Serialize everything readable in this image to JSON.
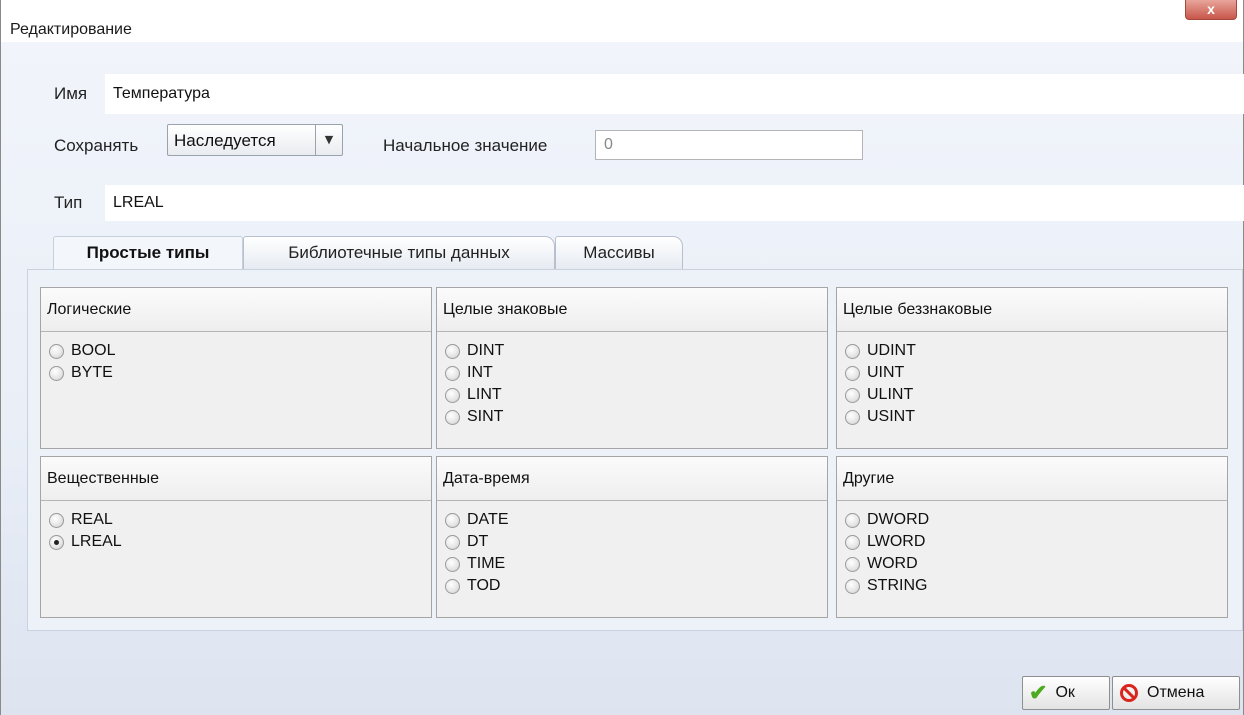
{
  "window": {
    "title": "Редактирование",
    "close_label": "x"
  },
  "form": {
    "name_label": "Имя",
    "name_value": "Температура",
    "save_label": "Сохранять",
    "save_value": "Наследуется",
    "initial_label": "Начальное значение",
    "initial_value": "0",
    "type_label": "Тип",
    "type_value": "LREAL"
  },
  "tabs": [
    {
      "label": "Простые типы",
      "selected": true
    },
    {
      "label": "Библиотечные типы данных",
      "selected": false
    },
    {
      "label": "Массивы",
      "selected": false
    }
  ],
  "groups": [
    {
      "title": "Логические",
      "options": [
        {
          "label": "BOOL",
          "checked": false
        },
        {
          "label": "BYTE",
          "checked": false
        }
      ]
    },
    {
      "title": "Целые знаковые",
      "options": [
        {
          "label": "DINT",
          "checked": false
        },
        {
          "label": "INT",
          "checked": false
        },
        {
          "label": "LINT",
          "checked": false
        },
        {
          "label": "SINT",
          "checked": false
        }
      ]
    },
    {
      "title": "Целые беззнаковые",
      "options": [
        {
          "label": "UDINT",
          "checked": false
        },
        {
          "label": "UINT",
          "checked": false
        },
        {
          "label": "ULINT",
          "checked": false
        },
        {
          "label": "USINT",
          "checked": false
        }
      ]
    },
    {
      "title": "Вещественные",
      "options": [
        {
          "label": "REAL",
          "checked": false
        },
        {
          "label": "LREAL",
          "checked": true
        }
      ]
    },
    {
      "title": "Дата-время",
      "options": [
        {
          "label": "DATE",
          "checked": false
        },
        {
          "label": "DT",
          "checked": false
        },
        {
          "label": "TIME",
          "checked": false
        },
        {
          "label": "TOD",
          "checked": false
        }
      ]
    },
    {
      "title": "Другие",
      "options": [
        {
          "label": "DWORD",
          "checked": false
        },
        {
          "label": "LWORD",
          "checked": false
        },
        {
          "label": "WORD",
          "checked": false
        },
        {
          "label": "STRING",
          "checked": false
        }
      ]
    }
  ],
  "buttons": {
    "ok_label": "Ок",
    "cancel_label": "Отмена"
  },
  "colors": {
    "ok_check": "#4caa1f",
    "cancel_icon": "#d9261c",
    "close_button": "#c8564a"
  }
}
